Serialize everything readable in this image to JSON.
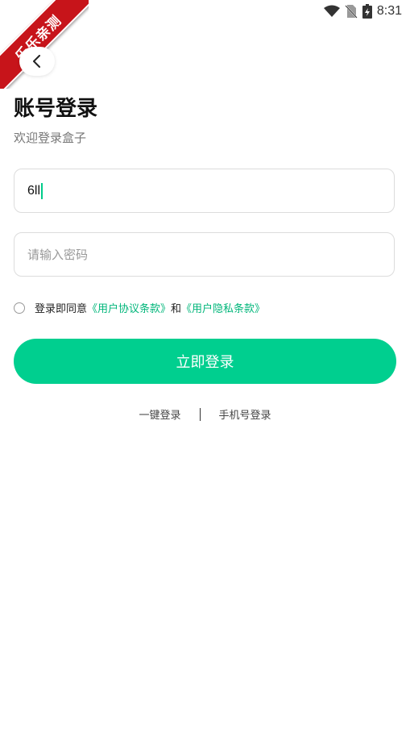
{
  "status_bar": {
    "time": "8:31",
    "icons": [
      "wifi-icon",
      "no-sim-icon",
      "battery-charging-icon"
    ]
  },
  "watermark": {
    "text": "乐乐亲测",
    "color": "#c7141a"
  },
  "header": {
    "back_icon": "chevron-left-icon",
    "title": "账号登录",
    "subtitle": "欢迎登录盒子"
  },
  "form": {
    "account_value": "6ll",
    "password_placeholder": "请输入密码"
  },
  "agreement": {
    "prefix": "登录即同意",
    "link1": "《用户协议条款》",
    "conjunction": "和",
    "link2": "《用户隐私条款》"
  },
  "login_button": {
    "label": "立即登录",
    "color": "#00cf8f"
  },
  "alt_logins": {
    "one_click": "一键登录",
    "phone": "手机号登录"
  }
}
